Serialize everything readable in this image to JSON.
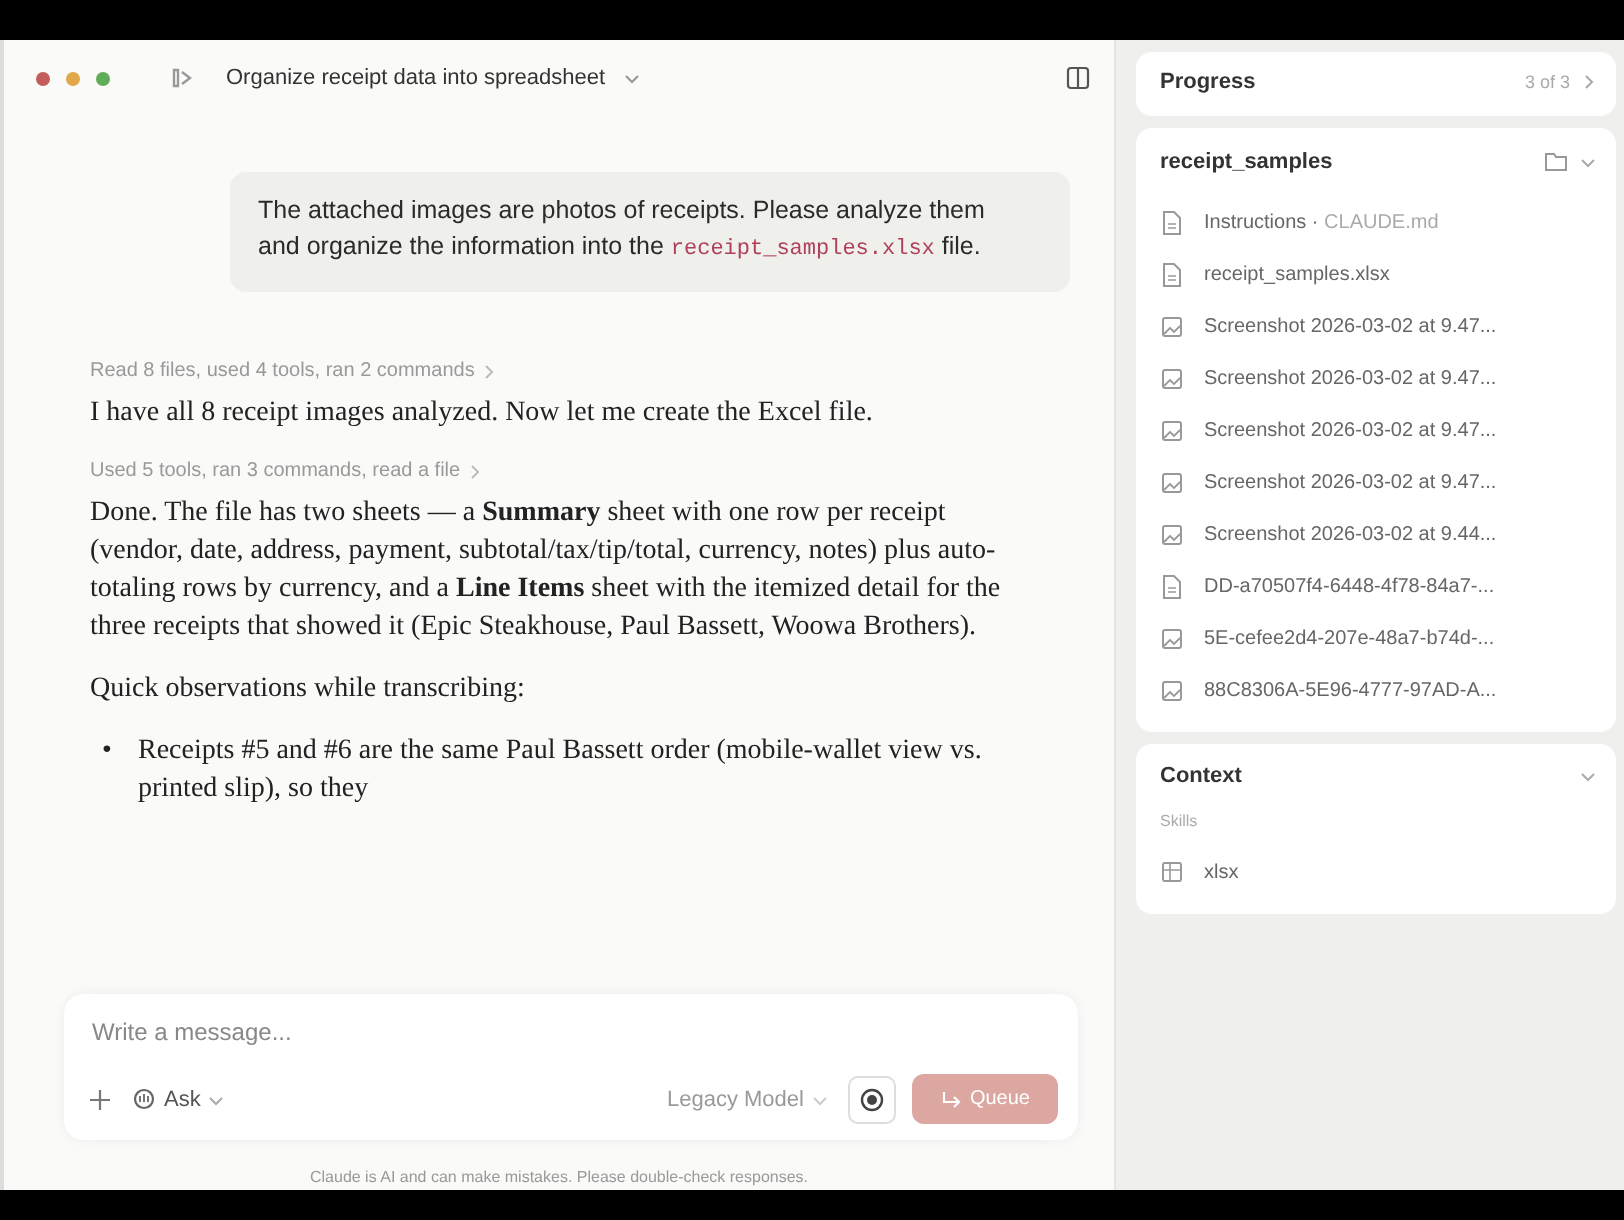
{
  "window": {
    "title": "Organize receipt data into spreadsheet"
  },
  "user_message": {
    "text": "The attached images are photos of receipts. Please analyze them and organize the information into the ",
    "code": "receipt_samples.xlsx",
    "text_after": " file."
  },
  "messages": [
    {
      "kind": "activity",
      "text": "Read 8 files, used 4 tools, ran 2 commands"
    },
    {
      "kind": "paragraph",
      "text": "I have all 8 receipt images analyzed. Now let me create the Excel file."
    },
    {
      "kind": "activity",
      "text": "Used 5 tools, ran 3 commands, read a file"
    },
    {
      "kind": "paragraph",
      "text": "Done. The file has two sheets — a **Summary** sheet with one row per receipt (vendor, date, address, payment, subtotal/tax/tip/total, currency, notes) plus auto-totaling rows by currency, and a **Line Items** sheet with the itemized detail for the three receipts that showed it (Epic Steakhouse, Paul Bassett, Woowa Brothers)."
    },
    {
      "kind": "paragraph",
      "text": "Quick observations while transcribing:"
    },
    {
      "kind": "bullet",
      "marker": "•",
      "text": "Receipts #5 and #6 are the same Paul Bassett order (mobile-wallet view vs. printed slip), so they"
    }
  ],
  "composer": {
    "placeholder": "Write a message...",
    "mode": "Ask",
    "model": "Legacy Model",
    "send": "Queue"
  },
  "disclaimer": "Claude is AI and can make mistakes. Please double-check responses.",
  "progress": {
    "title": "Progress",
    "count": "3 of 3"
  },
  "folder": {
    "name": "receipt_samples",
    "files": [
      {
        "kind": "doc",
        "name": "Instructions",
        "separator": "·",
        "note": "CLAUDE.md"
      },
      {
        "kind": "doc",
        "name": "receipt_samples.xlsx"
      },
      {
        "kind": "image",
        "name": "Screenshot 2026-03-02 at 9.47..."
      },
      {
        "kind": "image",
        "name": "Screenshot 2026-03-02 at 9.47..."
      },
      {
        "kind": "image",
        "name": "Screenshot 2026-03-02 at 9.47..."
      },
      {
        "kind": "image",
        "name": "Screenshot 2026-03-02 at 9.47..."
      },
      {
        "kind": "image",
        "name": "Screenshot 2026-03-02 at 9.44..."
      },
      {
        "kind": "doc",
        "name": "DD-a70507f4-6448-4f78-84a7-..."
      },
      {
        "kind": "image",
        "name": "5E-cefee2d4-207e-48a7-b74d-..."
      },
      {
        "kind": "image",
        "name": "88C8306A-5E96-4777-97AD-A..."
      }
    ]
  },
  "context": {
    "title": "Context",
    "section": "Skills",
    "items": [
      "xlsx"
    ]
  }
}
